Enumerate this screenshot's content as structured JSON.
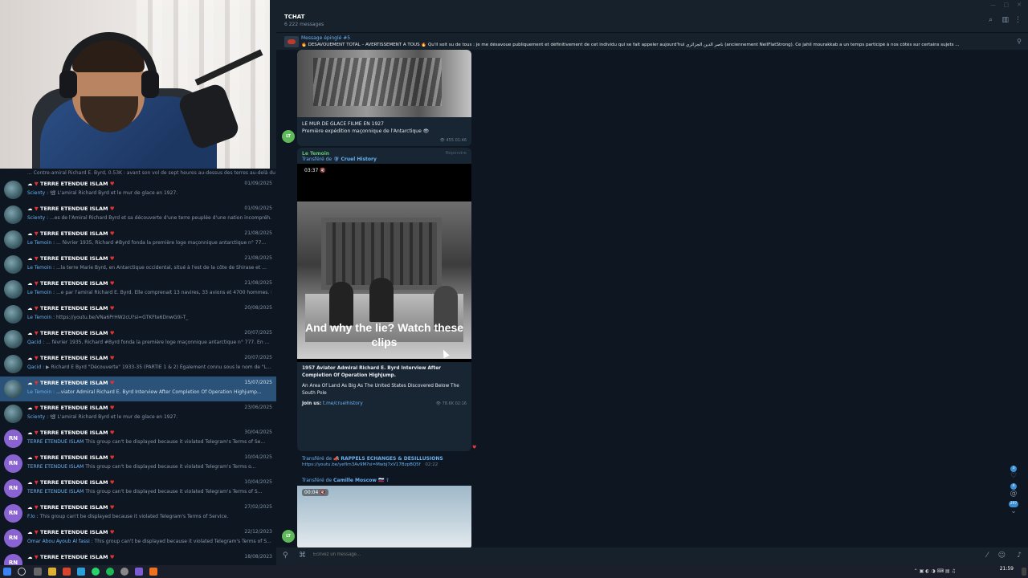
{
  "chat": {
    "name": "TCHAT",
    "message_count": "6 222 messages"
  },
  "pinned": {
    "title": "Message épinglé #5",
    "text": "🔥 DÉSAVOUEMENT TOTAL – AVERTISSEMENT À TOUS 🔥 Qu'il soit su de tous : je me désavoue publiquement et définitivement de cet individu qui se fait appeler aujourd'hui ناصر الدين الجزائري (anciennement NeilFlatStrong). Ce jahil mourakkab a un temps participé à nos côtés sur certains sujets ..."
  },
  "chatlist": {
    "cut_row": "... Contre-amiral Richard E. Byrd, 0.53K : avant son vol de sept heures au-dessus des terres au-delà du ...",
    "items": [
      {
        "title": "TERRE ETENDUE ISLAM",
        "sender": "Scienty :",
        "preview": "📽 L'amiral Richard Byrd et le mur de glace en 1927.",
        "date": "01/09/2025",
        "avatar": "globe",
        "active": false
      },
      {
        "title": "TERRE ETENDUE ISLAM",
        "sender": "Scienty :",
        "preview": "...es de l'Amiral Richard Byrd et sa découverte d'une terre peuplée d'une nation incompréh...",
        "date": "01/09/2025",
        "avatar": "globe",
        "active": false
      },
      {
        "title": "TERRE ETENDUE ISLAM",
        "sender": "Le Temoin :",
        "preview": "... février 1935, Richard #Byrd fonda la première loge maçonnique antarctique n° 77...",
        "date": "21/08/2025",
        "avatar": "globe",
        "active": false
      },
      {
        "title": "TERRE ETENDUE ISLAM",
        "sender": "Le Temoin :",
        "preview": "...la terre Marie Byrd, en Antarctique occidental, situé à l'est de la côte de Shirase et ...",
        "date": "21/08/2025",
        "avatar": "globe",
        "active": false
      },
      {
        "title": "TERRE ETENDUE ISLAM",
        "sender": "Le Temoin :",
        "preview": "...e par l'amiral Richard E. Byrd. Elle comprenait 13 navires, 33 avions et 4700 hommes. L...",
        "date": "21/08/2025",
        "avatar": "globe",
        "active": false
      },
      {
        "title": "TERRE ETENDUE ISLAM",
        "sender": "Le Temoin :",
        "preview": "https://youtu.be/VNa6PrHW2cU?si=GTKFte6DnwG0i-T_",
        "date": "20/08/2025",
        "avatar": "globe",
        "active": false
      },
      {
        "title": "TERRE ETENDUE ISLAM",
        "sender": "Qacid :",
        "preview": "... février 1935, Richard #Byrd fonda la première loge maçonnique antarctique n° 777. En ...",
        "date": "20/07/2025",
        "avatar": "globe",
        "active": false
      },
      {
        "title": "TERRE ETENDUE ISLAM",
        "sender": "Qacid :",
        "preview": "▶ Richard E Byrd \"Découverte\" 1933-35 (PARTIE 1 & 2) Également connu sous le nom de \"L...",
        "date": "20/07/2025",
        "avatar": "globe",
        "active": false
      },
      {
        "title": "TERRE ETENDUE ISLAM",
        "sender": "Le Temoin :",
        "preview": "...viator Admiral Richard E. Byrd Interview After Completion Of Operation Highjump...",
        "date": "15/07/2025",
        "avatar": "globe",
        "active": true
      },
      {
        "title": "TERRE ETENDUE ISLAM",
        "sender": "Scienty :",
        "preview": "📽 L'amiral Richard Byrd et le mur de glace en 1927.",
        "date": "23/06/2025",
        "avatar": "globe",
        "active": false
      },
      {
        "title": "TERRE ETENDUE ISLAM",
        "sender": "TERRE ETENDUE ISLAM",
        "preview": "This group can't be displayed because it violated Telegram's Terms of Se...",
        "date": "30/04/2025",
        "avatar": "RN",
        "active": false
      },
      {
        "title": "TERRE ETENDUE ISLAM",
        "sender": "TERRE ETENDUE ISLAM",
        "preview": "This group can't be displayed because it violated Telegram's Terms o...",
        "date": "10/04/2025",
        "avatar": "RN",
        "active": false
      },
      {
        "title": "TERRE ETENDUE ISLAM",
        "sender": "TERRE ETENDUE ISLAM",
        "preview": "This group can't be displayed because it violated Telegram's Terms of S...",
        "date": "10/04/2025",
        "avatar": "RN",
        "active": false
      },
      {
        "title": "TERRE ETENDUE ISLAM",
        "sender": "F.lo :",
        "preview": "This group can't be displayed because it violated Telegram's Terms of Service.",
        "date": "27/02/2025",
        "avatar": "RN",
        "active": false
      },
      {
        "title": "TERRE ETENDUE ISLAM",
        "sender": "Omar Abou Ayoub Al fassi :",
        "preview": "This group can't be displayed because it violated Telegram's Terms of S...",
        "date": "22/12/2023",
        "avatar": "RN",
        "active": false
      },
      {
        "title": "TERRE ETENDUE ISLAM",
        "sender": "",
        "preview": "",
        "date": "18/08/2023",
        "avatar": "RN",
        "active": false
      }
    ]
  },
  "msg1": {
    "caption_line1": "LE MUR DE GLACE FILME EN 1927",
    "caption_line2": "Première expédition maçonnique de l'Antarctique 👁",
    "meta": "👁 455  01:46",
    "avatar": "LT"
  },
  "msg2": {
    "sender": "Le Temoin",
    "forwarded_prefix": "Transféré de",
    "forwarded_from": "Cruel History",
    "reply": "Répondre",
    "duration": "03:37 🔇",
    "subtitle": "And why the lie? Watch these clips",
    "title_text": "1957 Aviator Admiral Richard E. Byrd Interview After Completion Of Operation Highjump.",
    "body": "An Area Of Land As Big As The United States Discovered Below The South Pole",
    "join_label": "Join us:",
    "join_link": "t.me/cruelhistory",
    "meta": "👁 78.6K  02:16"
  },
  "msg3": {
    "forwarded_prefix": "Transféré de",
    "forwarded_from": "RAPPELS ECHANGES & DESILLUSIONS",
    "link": "https://youtu.be/yefIrn3Av9M?si=Mwbj7xV17BzpBQ5f",
    "time": "02:22"
  },
  "msg4": {
    "forwarded_prefix": "Transféré de",
    "forwarded_from": "Camille Moscow 🇷🇺 ☦",
    "duration": "00:04 🔇",
    "avatar": "LT"
  },
  "side": {
    "badge_top": "3",
    "badge_mid": "4",
    "badge_bottom": "297"
  },
  "composer": {
    "placeholder": "Écrivez un message..."
  },
  "taskbar": {
    "time": "21:59",
    "date": ""
  }
}
